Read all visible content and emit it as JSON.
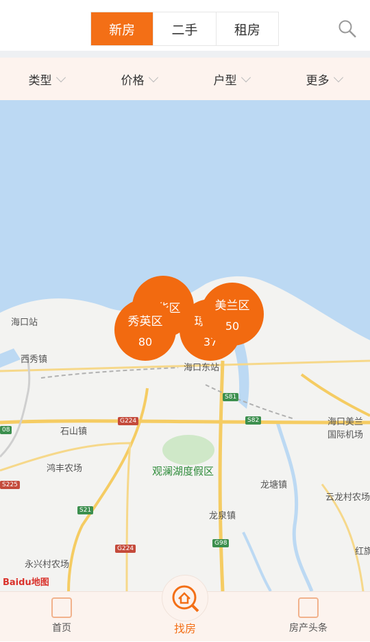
{
  "top_tabs": [
    {
      "label": "新房",
      "active": true
    },
    {
      "label": "二手",
      "active": false
    },
    {
      "label": "租房",
      "active": false
    }
  ],
  "filters": [
    {
      "label": "类型"
    },
    {
      "label": "价格"
    },
    {
      "label": "户型"
    },
    {
      "label": "更多"
    }
  ],
  "map": {
    "labels": {
      "haikou_station": "海口站",
      "xixiu_town": "西秀镇",
      "haikou_east": "海口东站",
      "shishan": "石山镇",
      "hongfeng": "鸿丰农场",
      "guanlan": "观澜湖度假区",
      "longtang": "龙塘镇",
      "longquan": "龙泉镇",
      "yunlong": "云龙村农场",
      "yongxing": "永兴村农场",
      "airport1": "海口美兰",
      "airport2": "国际机场",
      "hongqi": "红旗",
      "qiong": "琼"
    },
    "roads": {
      "s81": "S81",
      "s82": "S82",
      "g224a": "G224",
      "g224b": "G224",
      "s21": "S21",
      "g98": "G98",
      "s225": "S225",
      "r08": "08"
    },
    "clusters": [
      {
        "name": "龙华区",
        "count": ""
      },
      {
        "name": "秀英区",
        "count": "80"
      },
      {
        "name": "美兰区",
        "count": "50"
      },
      {
        "name": "琼",
        "count": "37"
      }
    ],
    "brand": "Baidu地图"
  },
  "bottom_nav": [
    {
      "label": "首页",
      "active": false
    },
    {
      "label": "找房",
      "active": true
    },
    {
      "label": "房产头条",
      "active": false
    }
  ],
  "colors": {
    "accent": "#f36f16",
    "cluster": "#f26a10",
    "sea": "#bcd9f3",
    "land": "#f3f3f1"
  }
}
